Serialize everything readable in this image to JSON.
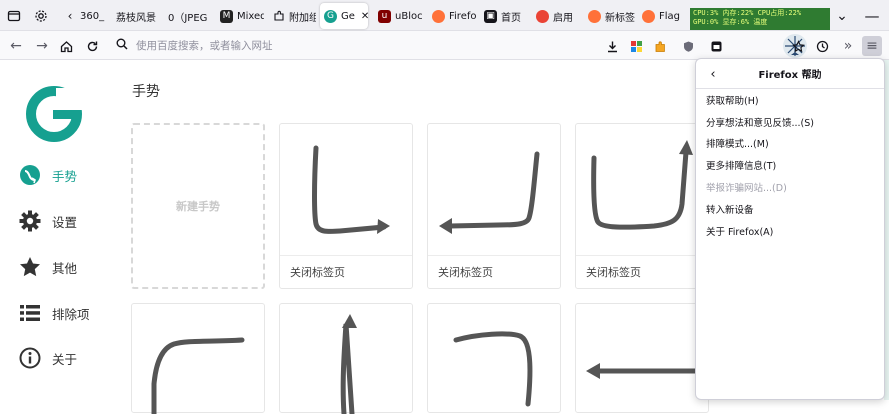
{
  "tabs": [
    {
      "label": "360_",
      "icon": "page-icon"
    },
    {
      "label": "荔枝风景",
      "icon": "page-icon"
    },
    {
      "label": "0（JPEG",
      "icon": "page-icon"
    },
    {
      "label": "Mixed",
      "icon": "mixed-icon"
    },
    {
      "label": "附加组",
      "icon": "puzzle-icon"
    },
    {
      "label": "Ge",
      "icon": "gesture-app-icon",
      "active": true
    },
    {
      "label": "uBloc",
      "icon": "ublock-icon"
    },
    {
      "label": "Firefo",
      "icon": "firefox-icon"
    },
    {
      "label": "首页",
      "icon": "home-tab-icon"
    },
    {
      "label": "启用",
      "icon": "chrome-icon"
    },
    {
      "label": "新标签",
      "icon": "firefox-icon"
    },
    {
      "label": "Flag",
      "icon": "firefox-icon"
    }
  ],
  "system_monitor": {
    "line1": "CPU:3% 内存:22% CPU占用:22%",
    "line2": "GPU:0% 显存:6% 温度"
  },
  "urlbar": {
    "placeholder": "使用百度搜索，或者输入网址"
  },
  "colors": {
    "accent": "#16a090",
    "tabbar_bg": "#f0f0f4",
    "sysmon_bg": "#2f7b31"
  },
  "sidebar": {
    "items": [
      {
        "label": "手势",
        "icon": "gesture-icon",
        "active": true
      },
      {
        "label": "设置",
        "icon": "gear-icon"
      },
      {
        "label": "其他",
        "icon": "star-icon"
      },
      {
        "label": "排除项",
        "icon": "list-icon"
      },
      {
        "label": "关于",
        "icon": "info-icon"
      }
    ]
  },
  "main": {
    "section_title": "手势",
    "new_gesture_label": "新建手势",
    "gestures": [
      {
        "label": "关闭标签页",
        "icon": "gesture-down-right-stroke"
      },
      {
        "label": "关闭标签页",
        "icon": "gesture-down-left-stroke"
      },
      {
        "label": "关闭标签页",
        "icon": "gesture-down-right-up-stroke"
      }
    ],
    "second_row": [
      {
        "icon": "gesture-curve-stroke"
      },
      {
        "icon": "gesture-up-stroke"
      },
      {
        "icon": "gesture-curve-left-stroke"
      },
      {
        "icon": "gesture-left-stroke"
      }
    ]
  },
  "help_panel": {
    "title": "Firefox 帮助",
    "items": [
      {
        "label": "获取帮助(H)",
        "disabled": false
      },
      {
        "label": "分享想法和意见反馈...(S)",
        "disabled": false
      },
      {
        "label": "排障模式...(M)",
        "disabled": false
      },
      {
        "label": "更多排障信息(T)",
        "disabled": false
      },
      {
        "label": "举报诈骗网站...(D)",
        "disabled": true
      },
      {
        "label": "转入新设备",
        "disabled": false
      },
      {
        "label": "关于 Firefox(A)",
        "disabled": false
      }
    ]
  }
}
